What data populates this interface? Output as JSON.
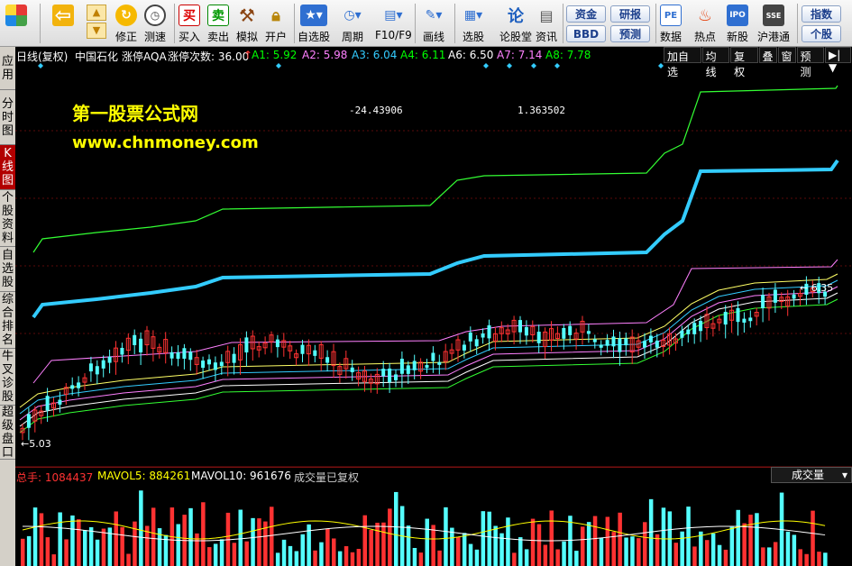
{
  "toolbar": {
    "buttons": [
      {
        "name": "home-icon",
        "label": ""
      },
      {
        "name": "back-icon",
        "label": ""
      },
      {
        "name": "revise-icon",
        "label": "修正"
      },
      {
        "name": "speed-test-icon",
        "label": "测速"
      },
      {
        "name": "buy-icon",
        "label": "买入",
        "glyph": "买"
      },
      {
        "name": "sell-icon",
        "label": "卖出",
        "glyph": "卖"
      },
      {
        "name": "simulate-icon",
        "label": "模拟"
      },
      {
        "name": "open-account-icon",
        "label": "开户"
      },
      {
        "name": "watchlist-icon",
        "label": "自选股"
      },
      {
        "name": "period-icon",
        "label": "周期"
      },
      {
        "name": "f10-icon",
        "label": "F10/F9"
      },
      {
        "name": "draw-icon",
        "label": "画线"
      },
      {
        "name": "stock-pick-icon",
        "label": "选股"
      },
      {
        "name": "forum-icon",
        "label": "论股堂"
      },
      {
        "name": "news-icon",
        "label": "资讯"
      },
      {
        "name": "data-icon",
        "label": "数据"
      },
      {
        "name": "hot-icon",
        "label": "热点"
      },
      {
        "name": "new-stock-icon",
        "label": "新股"
      },
      {
        "name": "hk-connect-icon",
        "label": "沪港通"
      }
    ],
    "small_buttons": {
      "funds": "资金",
      "bbd": "BBD",
      "research": "研报",
      "forecast": "预测",
      "index": "指数",
      "stock": "个股"
    }
  },
  "left_tabs": [
    {
      "label": "应用",
      "active": false
    },
    {
      "label": "分时图",
      "active": false
    },
    {
      "label": "K线图",
      "active": true
    },
    {
      "label": "个股资料",
      "active": false
    },
    {
      "label": "自选股",
      "active": false
    },
    {
      "label": "综合排名",
      "active": false
    },
    {
      "label": "牛叉诊股",
      "active": false
    },
    {
      "label": "超级盘口",
      "active": false
    }
  ],
  "infobar": {
    "period": "日线(复权)",
    "stock": "中国石化",
    "indicator": "涨停AQA",
    "count_label": "涨停次数: 36.00",
    "count_arrow": "↑",
    "series_labels": [
      {
        "label": "A1: 5.92",
        "color": "#00ff00"
      },
      {
        "label": "A2: 5.98",
        "color": "#ff80ff"
      },
      {
        "label": "A3: 6.04",
        "color": "#33ccff"
      },
      {
        "label": "A4: 6.11",
        "color": "#00ff00"
      },
      {
        "label": "A6: 6.50",
        "color": "#ffffff"
      },
      {
        "label": "A7: 7.14",
        "color": "#ff80ff"
      },
      {
        "label": "A8: 7.78",
        "color": "#00ff00"
      }
    ],
    "right_buttons": [
      "加自选",
      "均线",
      "复权",
      "叠",
      "窗",
      "预测",
      "▶|▼"
    ]
  },
  "chart": {
    "watermark_title": "第一股票公式网",
    "watermark_url": "www.chnmoney.com",
    "value_left": "-24.43906",
    "value_right": "1.363502",
    "high_label": "6.35",
    "low_label": "5.03"
  },
  "volume": {
    "total_label": "总手: 1084437",
    "ma5_label": "MAVOL5: 884261",
    "ma10_label": "MAVOL10: 961676",
    "note": "成交量已复权",
    "selector": "成交量"
  },
  "colors": {
    "up": "#ff3232",
    "down": "#54ffff",
    "accent_cyan": "#33ccff",
    "line_green": "#00ff00",
    "line_violet": "#ff80ff"
  }
}
